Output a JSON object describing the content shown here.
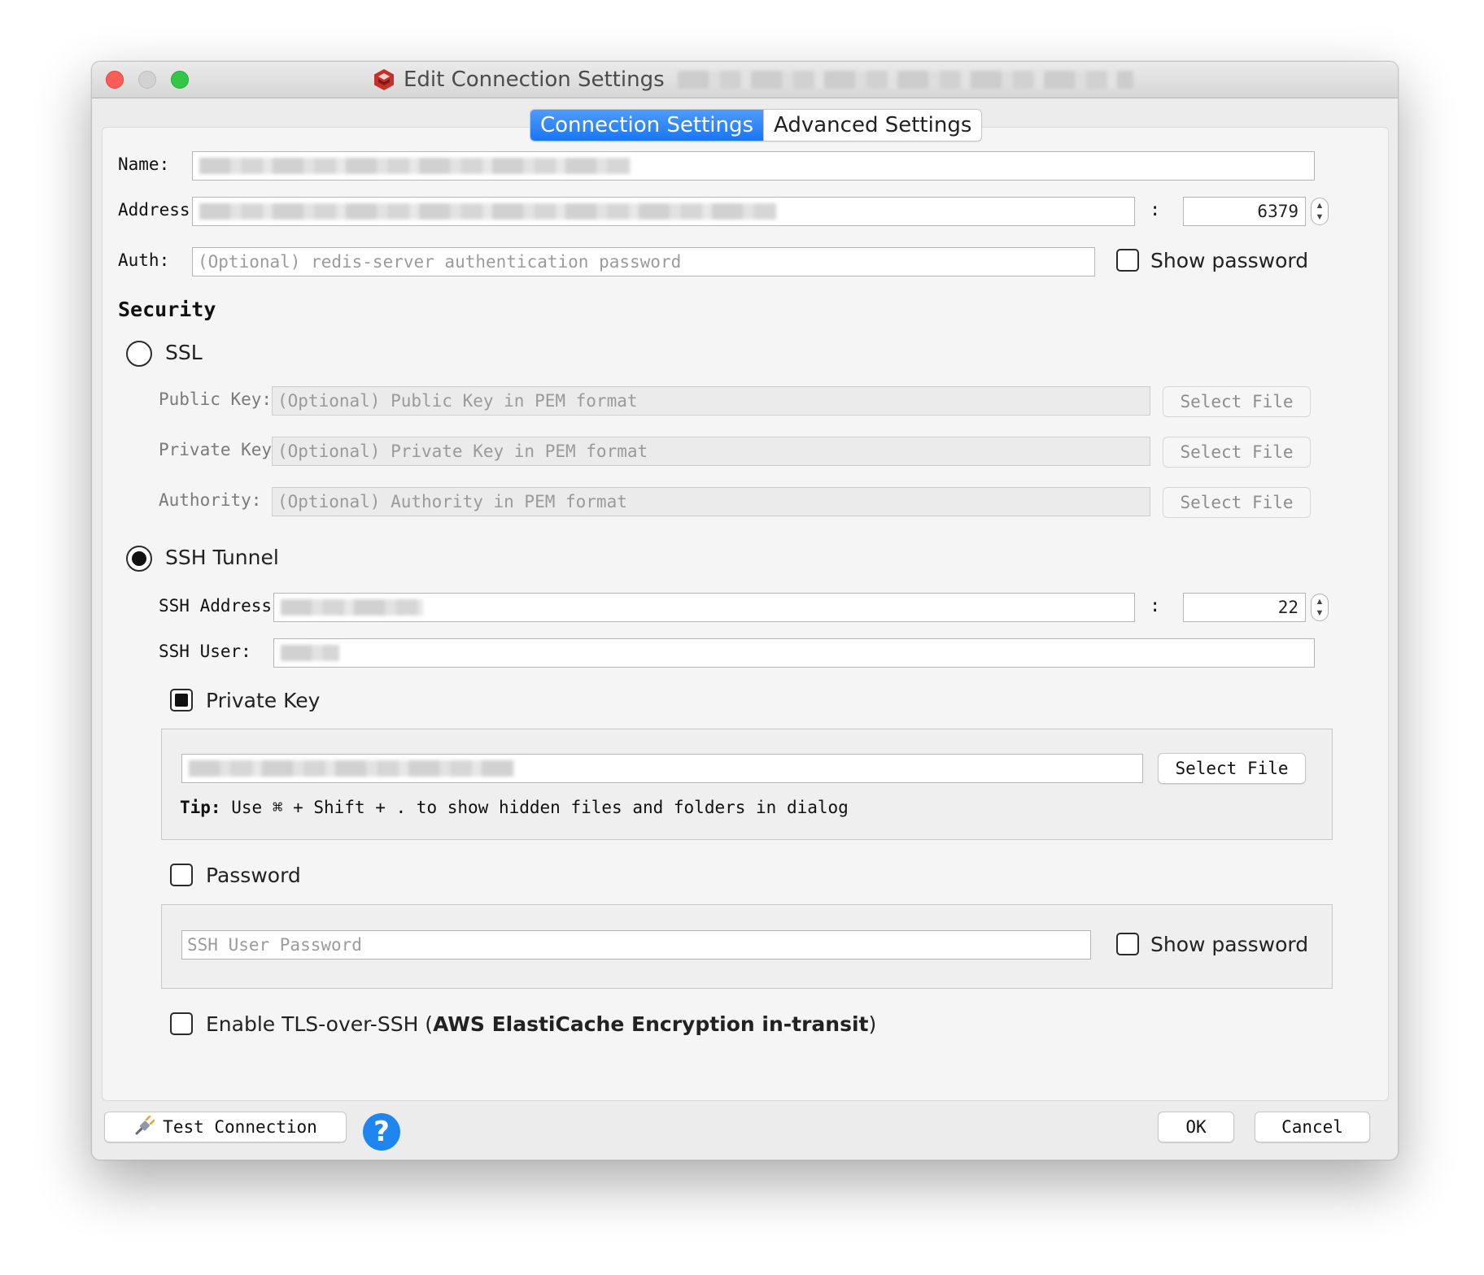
{
  "window": {
    "title": "Edit Connection Settings",
    "app_icon": "redis-logo-icon"
  },
  "tabs": [
    {
      "label": "Connection Settings",
      "active": true
    },
    {
      "label": "Advanced Settings",
      "active": false
    }
  ],
  "connection": {
    "name_label": "Name:",
    "address_label": "Address:",
    "port_separator": ":",
    "port_value": "6379",
    "auth_label": "Auth:",
    "auth_placeholder": "(Optional) redis-server authentication password",
    "show_password_label": "Show password"
  },
  "security": {
    "title": "Security",
    "ssl": {
      "label": "SSL",
      "selected": false,
      "public_key_label": "Public Key:",
      "public_key_placeholder": "(Optional) Public Key in PEM format",
      "private_key_label": "Private Key:",
      "private_key_placeholder": "(Optional) Private Key in PEM format",
      "authority_label": "Authority:",
      "authority_placeholder": "(Optional) Authority in PEM format",
      "select_file_label": "Select File"
    },
    "ssh": {
      "label": "SSH Tunnel",
      "selected": true,
      "address_label": "SSH Address:",
      "port_separator": ":",
      "port_value": "22",
      "user_label": "SSH User:",
      "private_key_label": "Private Key",
      "private_key_checked": true,
      "select_file_label": "Select File",
      "tip_prefix": "Tip:",
      "tip_text": "Use ⌘ + Shift + . to show hidden files and folders in dialog",
      "password_label": "Password",
      "password_checked": false,
      "password_placeholder": "SSH User Password",
      "show_password_label": "Show password",
      "tls_label_prefix": "Enable TLS-over-SSH (",
      "tls_label_bold": "AWS ElastiCache Encryption in-transit",
      "tls_label_suffix": ")",
      "tls_checked": false
    }
  },
  "footer": {
    "test_connection_label": "Test Connection",
    "help_label": "?",
    "ok_label": "OK",
    "cancel_label": "Cancel"
  }
}
